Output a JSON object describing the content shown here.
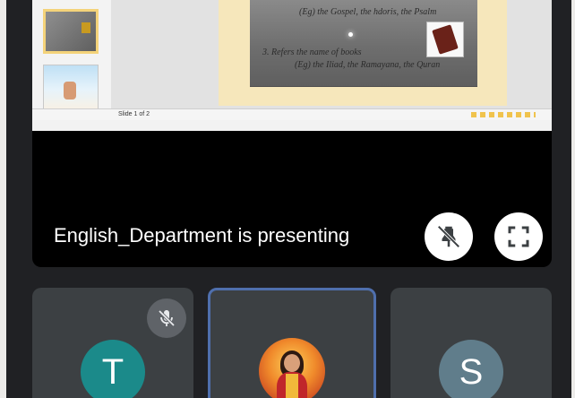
{
  "presentation": {
    "presenter_label": "English_Department is presenting",
    "slide": {
      "line_1": "(Eg) the Gospel, the hdoris, the Psalm",
      "line_2": "3. Refers the name of books",
      "line_3": "(Eg) the Iliad, the Ramayana, the Quran"
    },
    "status_bar_text": "Slide 1 of 2",
    "unpin_icon": "unpin-icon",
    "fullscreen_icon": "fullscreen-icon"
  },
  "participants": [
    {
      "initial": "T",
      "avatar_color": "#1b8a8a",
      "muted": true
    },
    {
      "initial": "",
      "avatar_type": "photo",
      "active_speaker_border": "#4f6fad"
    },
    {
      "initial": "S",
      "avatar_color": "#607d8b",
      "muted": false
    }
  ],
  "colors": {
    "background": "#202124",
    "tile": "#3c4043",
    "presenter_text": "#ffffff"
  }
}
